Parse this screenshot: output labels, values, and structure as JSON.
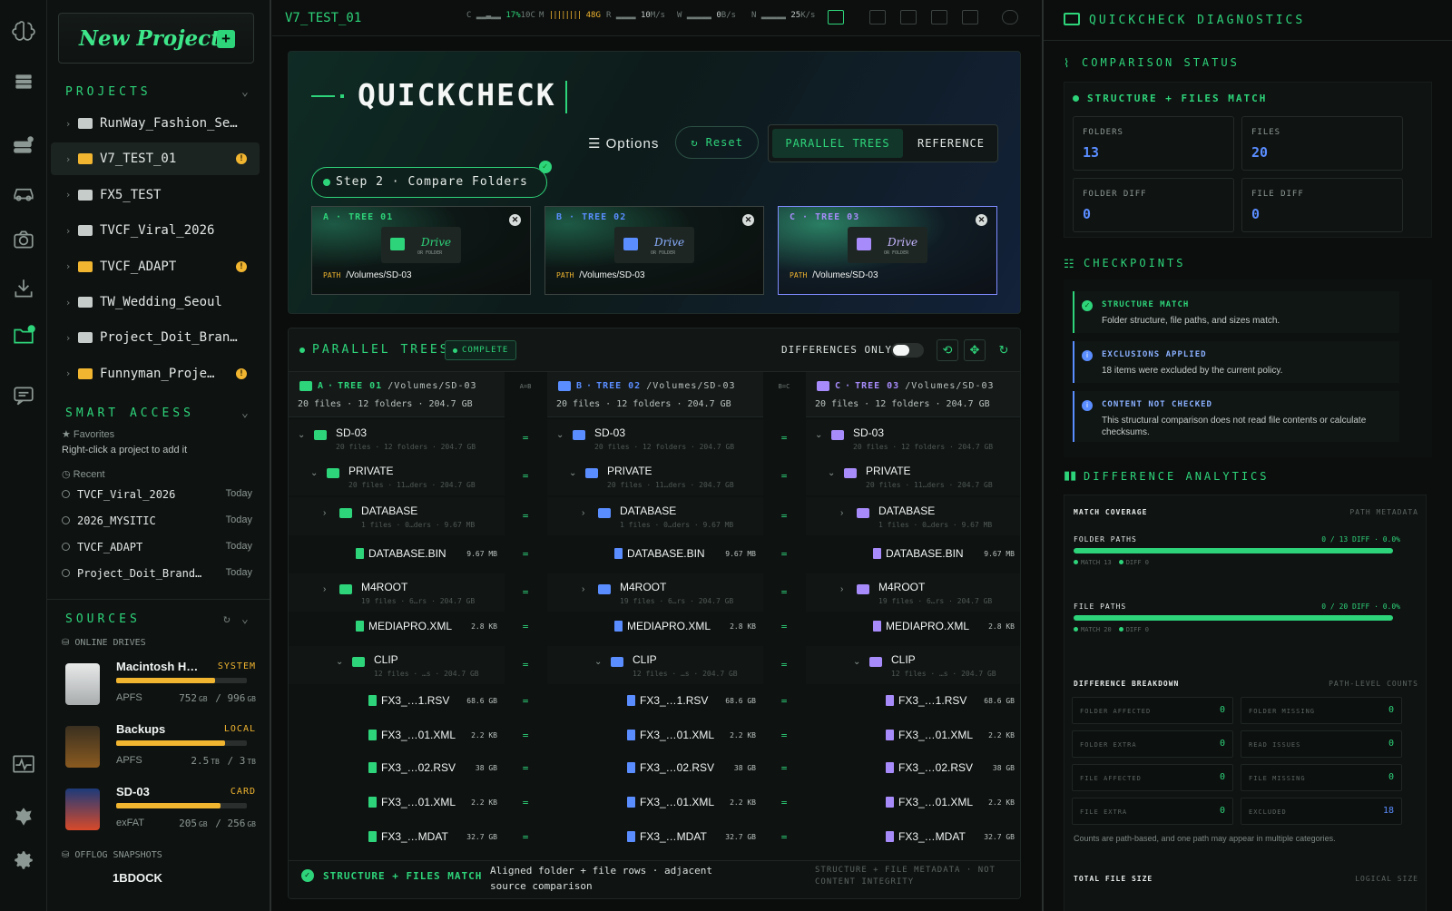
{
  "rail": {
    "icons": [
      "brain-icon",
      "stack-icon",
      "drives-icon",
      "car-icon",
      "camera-icon",
      "download-icon",
      "folder-check-icon",
      "chat-icon",
      "pulse-icon",
      "badge-icon",
      "gear-icon"
    ]
  },
  "sidebar": {
    "new_project": "New Project",
    "projects_label": "PROJECTS",
    "projects": [
      {
        "name": "RunWay_Fashion_Se…",
        "warn": false
      },
      {
        "name": "V7_TEST_01",
        "warn": true,
        "selected": true
      },
      {
        "name": "FX5_TEST",
        "warn": false
      },
      {
        "name": "TVCF_Viral_2026",
        "warn": false
      },
      {
        "name": "TVCF_ADAPT",
        "warn": true
      },
      {
        "name": "TW_Wedding_Seoul",
        "warn": false
      },
      {
        "name": "Project_Doit_Bran…",
        "warn": false
      },
      {
        "name": "Funnyman_Proje…",
        "warn": true
      }
    ],
    "smart_access_label": "SMART ACCESS",
    "favorites_label": "Favorites",
    "favorites_hint": "Right-click a project to add it",
    "recent_label": "Recent",
    "recent": [
      {
        "name": "TVCF_Viral_2026",
        "when": "Today"
      },
      {
        "name": "2026_MYSITIC",
        "when": "Today"
      },
      {
        "name": "TVCF_ADAPT",
        "when": "Today"
      },
      {
        "name": "Project_Doit_Brand…",
        "when": "Today"
      }
    ],
    "sources_label": "SOURCES",
    "online_drives_label": "ONLINE DRIVES",
    "drives": [
      {
        "name": "Macintosh H…",
        "tag": "SYSTEM",
        "fs": "APFS",
        "used": "752",
        "used_unit": "GB",
        "total": "996",
        "total_unit": "GB",
        "fill": 0.755
      },
      {
        "name": "Backups",
        "tag": "LOCAL",
        "fs": "APFS",
        "used": "2.5",
        "used_unit": "TB",
        "total": "3",
        "total_unit": "TB",
        "fill": 0.83
      },
      {
        "name": "SD-03",
        "tag": "CARD",
        "fs": "exFAT",
        "used": "205",
        "used_unit": "GB",
        "total": "256",
        "total_unit": "GB",
        "fill": 0.8
      }
    ],
    "offlog_label": "OFFLOG SNAPSHOTS",
    "offlog_first": "1BDOCK"
  },
  "topbar": {
    "title": "V7_TEST_01",
    "cpu": "17%",
    "cpu_sub": "10C",
    "mem": "48G",
    "disk_read": "10",
    "disk_read_unit": "M/s",
    "disk_write": "0",
    "disk_write_unit": "B/s",
    "net": "25",
    "net_unit": "K/s"
  },
  "hero": {
    "title": "QUICKCHECK",
    "options": "Options",
    "reset": "Reset",
    "mode_parallel": "PARALLEL TREES",
    "mode_reference": "REFERENCE",
    "step": "Step 2 · Compare Folders",
    "cards": [
      {
        "label": "A · TREE 01",
        "drive": "Drive",
        "drive_sub": "OR FOLDER",
        "path_key": "PATH",
        "path": "/Volumes/SD-03"
      },
      {
        "label": "B · TREE 02",
        "drive": "Drive",
        "drive_sub": "OR FOLDER",
        "path_key": "PATH",
        "path": "/Volumes/SD-03"
      },
      {
        "label": "C · TREE 03",
        "drive": "Drive",
        "drive_sub": "OR FOLDER",
        "path_key": "PATH",
        "path": "/Volumes/SD-03"
      }
    ]
  },
  "trees": {
    "title": "PARALLEL TREES",
    "status": "COMPLETE",
    "differences_only": "DIFFERENCES ONLY",
    "sep_ab": "A=B",
    "sep_bc": "B=C",
    "columns": [
      {
        "letter": "A",
        "name": "TREE 01",
        "path": "/Volumes/SD-03",
        "stats": "20 files · 12 folders · 204.7 GB"
      },
      {
        "letter": "B",
        "name": "TREE 02",
        "path": "/Volumes/SD-03",
        "stats": "20 files · 12 folders · 204.7 GB"
      },
      {
        "letter": "C",
        "name": "TREE 03",
        "path": "/Volumes/SD-03",
        "stats": "20 files · 12 folders · 204.7 GB"
      }
    ],
    "rows": [
      {
        "name": "SD-03",
        "depth": 0,
        "type": "folder",
        "open": true,
        "sub": "20 files · 12 folders · 204.7 GB"
      },
      {
        "name": "PRIVATE",
        "depth": 1,
        "type": "folder",
        "open": true,
        "sub": "20 files · 11…ders · 204.7 GB"
      },
      {
        "name": "DATABASE",
        "depth": 2,
        "type": "folder",
        "open": false,
        "sub": "1 files · 0…ders · 9.67 MB"
      },
      {
        "name": "DATABASE.BIN",
        "depth": 3,
        "type": "file",
        "size": "9.67 MB"
      },
      {
        "name": "M4ROOT",
        "depth": 2,
        "type": "folder",
        "open": false,
        "sub": "19 files · 6…rs · 204.7 GB"
      },
      {
        "name": "MEDIAPRO.XML",
        "depth": 3,
        "type": "file",
        "size": "2.8 KB"
      },
      {
        "name": "CLIP",
        "depth": 3,
        "type": "folder",
        "open": true,
        "sub": "12 files · …s · 204.7 GB"
      },
      {
        "name": "FX3_…1.RSV",
        "depth": 4,
        "type": "file",
        "size": "68.6 GB"
      },
      {
        "name": "FX3_…01.XML",
        "depth": 4,
        "type": "file",
        "size": "2.2 KB"
      },
      {
        "name": "FX3_…02.RSV",
        "depth": 4,
        "type": "file",
        "size": "38 GB"
      },
      {
        "name": "FX3_…01.XML",
        "depth": 4,
        "type": "file",
        "size": "2.2 KB"
      },
      {
        "name": "FX3_…MDAT",
        "depth": 4,
        "type": "file",
        "size": "32.7 GB"
      }
    ],
    "eq": "=",
    "footer_status": "STRUCTURE + FILES MATCH",
    "footer_mid": "Aligned folder + file rows · adjacent source comparison",
    "footer_right": "STRUCTURE + FILE METADATA · NOT CONTENT INTEGRITY"
  },
  "diag": {
    "title": "QUICKCHECK DIAGNOSTICS",
    "comparison_label": "COMPARISON STATUS",
    "match_label": "STRUCTURE + FILES MATCH",
    "stats": [
      {
        "k": "FOLDERS",
        "v": "13"
      },
      {
        "k": "FILES",
        "v": "20"
      },
      {
        "k": "FOLDER DIFF",
        "v": "0"
      },
      {
        "k": "FILE DIFF",
        "v": "0"
      }
    ],
    "checkpoints_label": "CHECKPOINTS",
    "checkpoints": [
      {
        "t": "STRUCTURE MATCH",
        "d": "Folder structure, file paths, and sizes match.",
        "kind": "ok"
      },
      {
        "t": "EXCLUSIONS APPLIED",
        "d": "18 items were excluded by the current policy.",
        "kind": "info"
      },
      {
        "t": "CONTENT NOT CHECKED",
        "d": "This structural comparison does not read file contents or calculate checksums.",
        "kind": "info"
      }
    ],
    "analytics_label": "DIFFERENCE ANALYTICS",
    "match_coverage": "MATCH COVERAGE",
    "path_metadata": "PATH METADATA",
    "coverage": [
      {
        "label": "FOLDER PATHS",
        "right": "0 / 13 DIFF · 0.0%",
        "match": "MATCH 13",
        "diff": "DIFF 0",
        "fill": 1.0
      },
      {
        "label": "FILE PATHS",
        "right": "0 / 20 DIFF · 0.0%",
        "match": "MATCH 20",
        "diff": "DIFF 0",
        "fill": 1.0
      }
    ],
    "breakdown_label": "DIFFERENCE BREAKDOWN",
    "breakdown_right": "PATH-LEVEL COUNTS",
    "breakdown": [
      {
        "k": "FOLDER AFFECTED",
        "v": "0"
      },
      {
        "k": "FOLDER MISSING",
        "v": "0"
      },
      {
        "k": "FOLDER EXTRA",
        "v": "0"
      },
      {
        "k": "READ ISSUES",
        "v": "0"
      },
      {
        "k": "FILE AFFECTED",
        "v": "0"
      },
      {
        "k": "FILE MISSING",
        "v": "0"
      },
      {
        "k": "FILE EXTRA",
        "v": "0"
      },
      {
        "k": "EXCLUDED",
        "v": "18"
      }
    ],
    "breakdown_note": "Counts are path-based, and one path may appear in multiple categories.",
    "total_size_label": "TOTAL FILE SIZE",
    "total_size_right": "LOGICAL SIZE"
  },
  "colors": {
    "accent": "#2ed47a",
    "tree_b": "#5a8dff",
    "tree_c": "#a78bfa",
    "warn": "#f1b530"
  }
}
